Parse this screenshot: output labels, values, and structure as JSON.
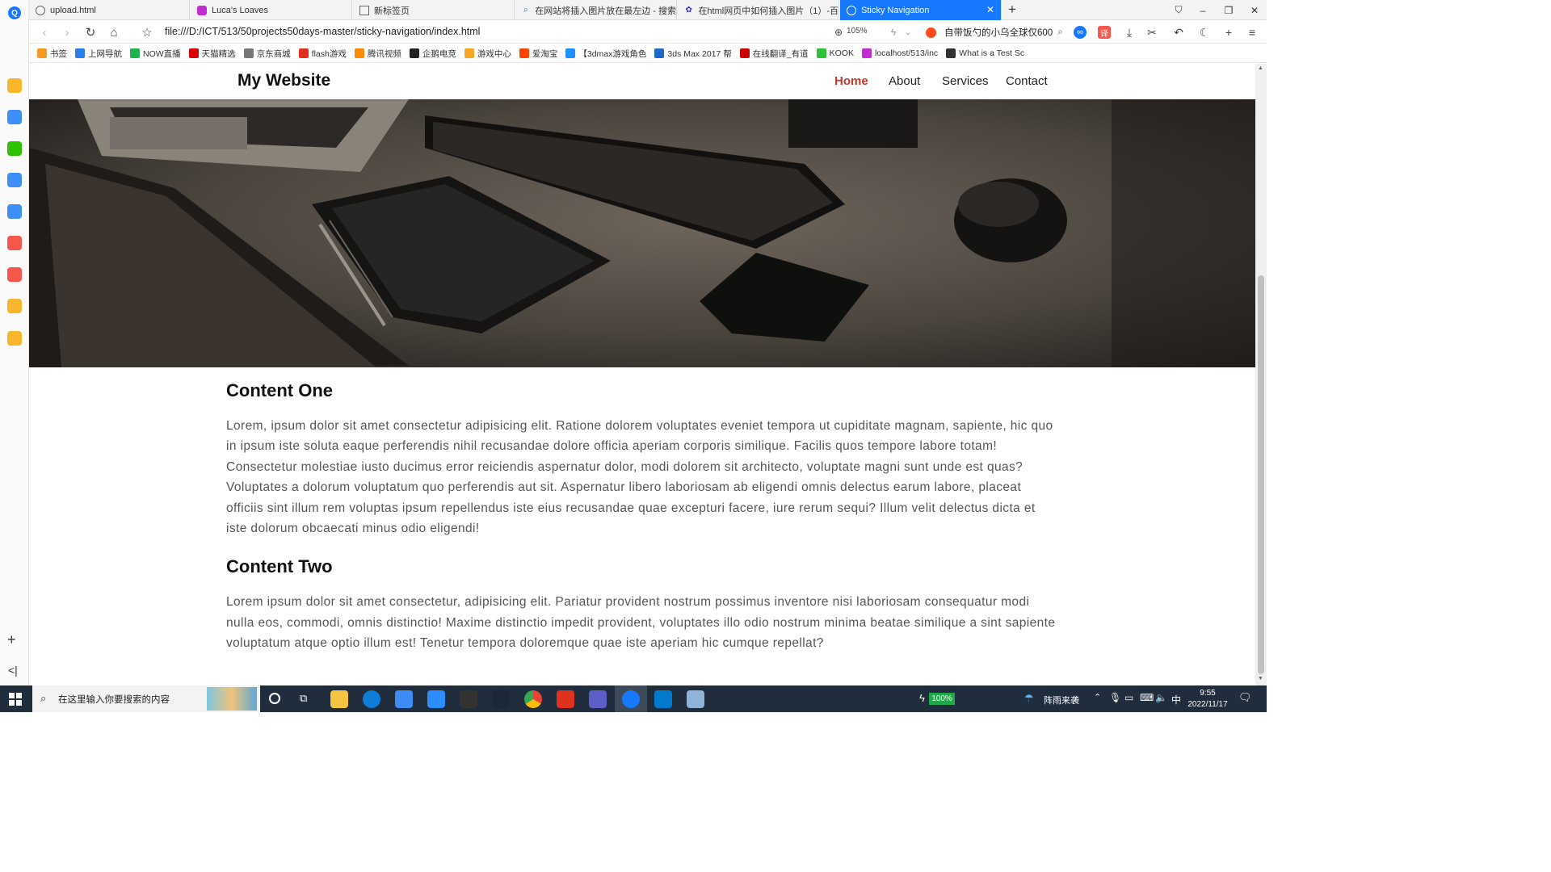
{
  "browser": {
    "tabs": [
      {
        "label": "upload.html"
      },
      {
        "label": "Luca's Loaves"
      },
      {
        "label": "新标签页"
      },
      {
        "label": "在网站将插入图片放在最左边 - 搜索"
      },
      {
        "label": "在html网页中如何插入图片（1）-百"
      },
      {
        "label": "Sticky Navigation",
        "active": true
      }
    ],
    "new_tab": "+",
    "url": "file:///D:/ICT/513/50projects50days-master/sticky-navigation/index.html",
    "zoom": "105%",
    "search_text": "自带饭勺的小乌全球仅600",
    "bookmarks": [
      {
        "label": "书签",
        "color": "#f59a23"
      },
      {
        "label": "上网导航",
        "color": "#2b7de9"
      },
      {
        "label": "NOW直播",
        "color": "#22b14c"
      },
      {
        "label": "天猫精选",
        "color": "#d00"
      },
      {
        "label": "京东商城",
        "color": "#777"
      },
      {
        "label": "flash游戏",
        "color": "#e0301e"
      },
      {
        "label": "腾讯视频",
        "color": "#ff8a00"
      },
      {
        "label": "企鹅电竞",
        "color": "#222"
      },
      {
        "label": "游戏中心",
        "color": "#f5a623"
      },
      {
        "label": "爱淘宝",
        "color": "#ff4400"
      },
      {
        "label": "【3dmax游戏角色",
        "color": "#1e90ff"
      },
      {
        "label": "3ds Max 2017 帮",
        "color": "#1b6ac9"
      },
      {
        "label": "在线翻译_有道",
        "color": "#c00"
      },
      {
        "label": "KOOK",
        "color": "#2fbf3a"
      },
      {
        "label": "localhost/513/inc",
        "color": "#c02ccf"
      },
      {
        "label": "What is a Test Sc",
        "color": "#333"
      }
    ]
  },
  "site": {
    "logo": "My Website",
    "nav": [
      {
        "label": "Home",
        "current": true
      },
      {
        "label": "About"
      },
      {
        "label": "Services"
      },
      {
        "label": "Contact"
      }
    ],
    "sections": [
      {
        "title": "Content One",
        "text": "Lorem, ipsum dolor sit amet consectetur adipisicing elit. Ratione dolorem voluptates eveniet tempora ut cupiditate magnam, sapiente, hic quo in ipsum iste soluta eaque perferendis nihil recusandae dolore officia aperiam corporis similique. Facilis quos tempore labore totam! Consectetur molestiae iusto ducimus error reiciendis aspernatur dolor, modi dolorem sit architecto, voluptate magni sunt unde est quas? Voluptates a dolorum voluptatum quo perferendis aut sit. Aspernatur libero laboriosam ab eligendi omnis delectus earum labore, placeat officiis sint illum rem voluptas ipsum repellendus iste eius recusandae quae excepturi facere, iure rerum sequi? Illum velit delectus dicta et iste dolorum obcaecati minus odio eligendi!"
      },
      {
        "title": "Content Two",
        "text": "Lorem ipsum dolor sit amet consectetur, adipisicing elit. Pariatur provident nostrum possimus inventore nisi laboriosam consequatur modi nulla eos, commodi, omnis distinctio! Maxime distinctio impedit provident, voluptates illo odio nostrum minima beatae similique a sint sapiente voluptatum atque optio illum est! Tenetur tempora doloremque quae iste aperiam hic cumque repellat?"
      }
    ],
    "accent_color": "#c0392b"
  },
  "taskbar": {
    "search_placeholder": "在这里输入你要搜索的内容",
    "battery": "100%",
    "weather": "阵雨来袭",
    "ime": "中",
    "time": "9:55",
    "date": "2022/11/17"
  }
}
